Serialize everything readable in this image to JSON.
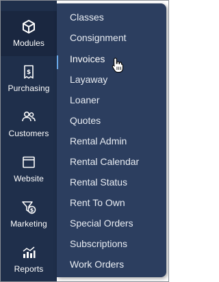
{
  "sidebar": {
    "items": [
      {
        "label": "Modules",
        "icon": "cube-icon"
      },
      {
        "label": "Purchasing",
        "icon": "receipt-icon"
      },
      {
        "label": "Customers",
        "icon": "users-icon"
      },
      {
        "label": "Website",
        "icon": "browser-window-icon"
      },
      {
        "label": "Marketing",
        "icon": "funnel-dollar-icon"
      },
      {
        "label": "Reports",
        "icon": "bar-chart-icon"
      }
    ]
  },
  "modules_menu": {
    "items": [
      "Classes",
      "Consignment",
      "Invoices",
      "Layaway",
      "Loaner",
      "Quotes",
      "Rental Admin",
      "Rental Calendar",
      "Rental Status",
      "Rent To Own",
      "Special Orders",
      "Subscriptions",
      "Work Orders"
    ],
    "hovered": "Invoices"
  },
  "colors": {
    "sidebar_bg": "#1f2f4b",
    "menu_bg": "#2c3e5f",
    "accent": "#6aa8e8"
  }
}
